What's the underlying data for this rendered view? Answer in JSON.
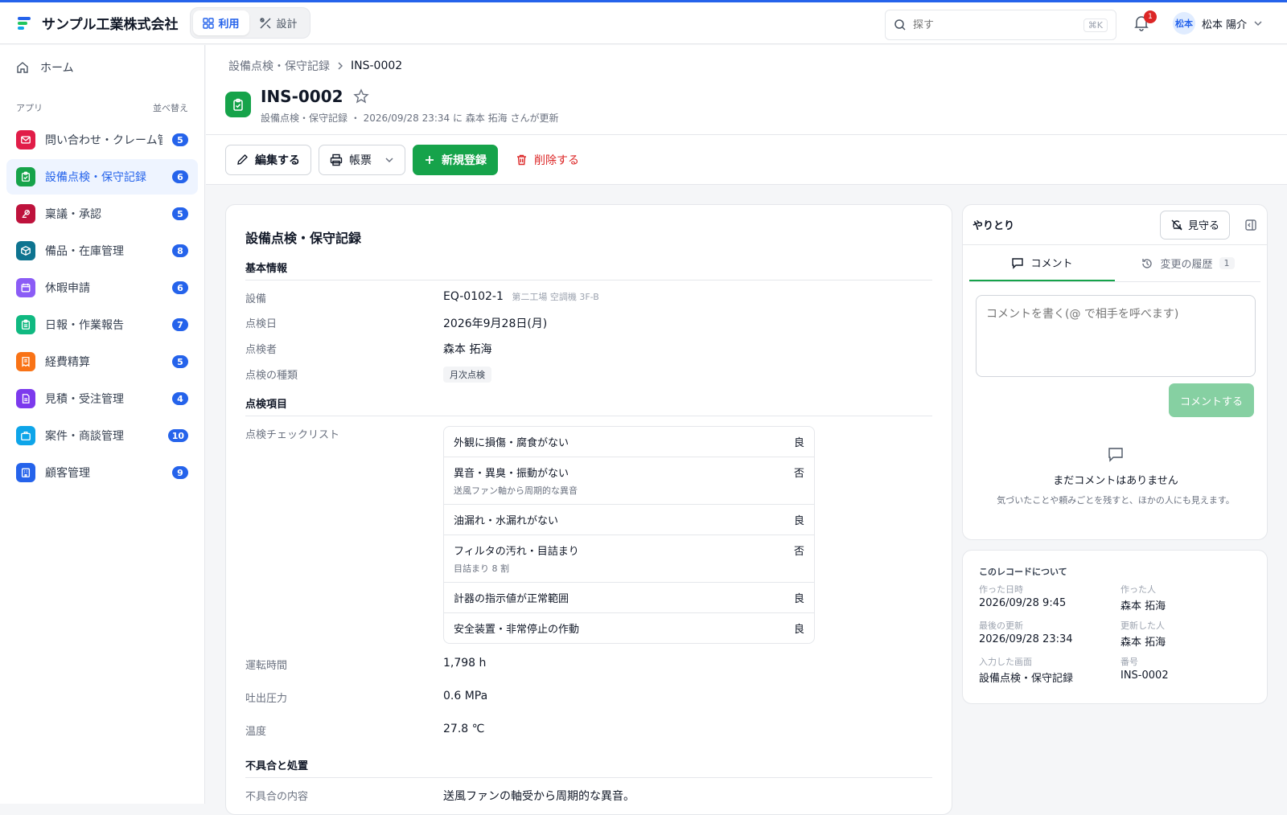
{
  "header": {
    "company": "サンプル工業株式会社",
    "modes": [
      {
        "label": "利用",
        "active": true
      },
      {
        "label": "設計",
        "active": false
      }
    ],
    "search_placeholder": "探す",
    "search_shortcut": "⌘K",
    "notification_count": "1",
    "user_avatar": "松本",
    "user_name": "松本 陽介"
  },
  "sidebar": {
    "home": "ホーム",
    "apps_heading": "アプリ",
    "sort_label": "並べ替え",
    "items": [
      {
        "label": "問い合わせ・クレーム管…",
        "count": "5",
        "color": "#e11d48",
        "icon": "mail-icon",
        "active": false
      },
      {
        "label": "設備点検・保守記録",
        "count": "6",
        "color": "#16a34a",
        "icon": "clipboard-check-icon",
        "active": true
      },
      {
        "label": "稟議・承認",
        "count": "5",
        "color": "#be123c",
        "icon": "stamp-icon",
        "active": false
      },
      {
        "label": "備品・在庫管理",
        "count": "8",
        "color": "#0e7490",
        "icon": "box-icon",
        "active": false
      },
      {
        "label": "休暇申請",
        "count": "6",
        "color": "#8b5cf6",
        "icon": "calendar-icon",
        "active": false
      },
      {
        "label": "日報・作業報告",
        "count": "7",
        "color": "#10b981",
        "icon": "clipboard-icon",
        "active": false
      },
      {
        "label": "経費精算",
        "count": "5",
        "color": "#f97316",
        "icon": "receipt-icon",
        "active": false
      },
      {
        "label": "見積・受注管理",
        "count": "4",
        "color": "#7c3aed",
        "icon": "document-icon",
        "active": false
      },
      {
        "label": "案件・商談管理",
        "count": "10",
        "color": "#0ea5e9",
        "icon": "briefcase-icon",
        "active": false
      },
      {
        "label": "顧客管理",
        "count": "9",
        "color": "#2563eb",
        "icon": "building-icon",
        "active": false
      }
    ]
  },
  "page": {
    "breadcrumb_parent": "設備点検・保守記録",
    "breadcrumb_current": "INS-0002",
    "title": "INS-0002",
    "subtitle": "設備点検・保守記録 ・ 2026/09/28 23:34 に 森本 拓海 さんが更新"
  },
  "toolbar": {
    "edit": "編集する",
    "print": "帳票",
    "create": "新規登録",
    "delete": "削除する"
  },
  "record": {
    "card_title": "設備点検・保守記録",
    "sections": {
      "basic": "基本情報",
      "items": "点検項目",
      "issues": "不具合と処置"
    },
    "equipment_label": "設備",
    "equipment_value": "EQ-0102-1",
    "equipment_note": "第二工場 空調機 3F-B",
    "date_label": "点検日",
    "date_value": "2026年9月28日(月)",
    "inspector_label": "点検者",
    "inspector_value": "森本 拓海",
    "type_label": "点検の種類",
    "type_value": "月次点検",
    "checklist_label": "点検チェックリスト",
    "checklist": [
      {
        "item": "外観に損傷・腐食がない",
        "result": "良",
        "note": ""
      },
      {
        "item": "異音・異臭・振動がない",
        "result": "否",
        "note": "送風ファン軸から周期的な異音"
      },
      {
        "item": "油漏れ・水漏れがない",
        "result": "良",
        "note": ""
      },
      {
        "item": "フィルタの汚れ・目詰まり",
        "result": "否",
        "note": "目詰まり 8 割"
      },
      {
        "item": "計器の指示値が正常範囲",
        "result": "良",
        "note": ""
      },
      {
        "item": "安全装置・非常停止の作動",
        "result": "良",
        "note": ""
      }
    ],
    "hours_label": "運転時間",
    "hours_value": "1,798 h",
    "pressure_label": "吐出圧力",
    "pressure_value": "0.6 MPa",
    "temp_label": "温度",
    "temp_value": "27.8 ℃",
    "issue_label": "不具合の内容",
    "issue_value": "送風ファンの軸受から周期的な異音。"
  },
  "comments": {
    "title": "やりとり",
    "watch": "見守る",
    "tab_comment": "コメント",
    "tab_history": "変更の履歴",
    "history_count": "1",
    "placeholder": "コメントを書く(@ で相手を呼べます)",
    "submit": "コメントする",
    "empty_title": "まだコメントはありません",
    "empty_desc": "気づいたことや頼みごとを残すと、ほかの人にも見えます。"
  },
  "about": {
    "title": "このレコードについて",
    "fields": [
      {
        "key": "作った日時",
        "value": "2026/09/28 9:45"
      },
      {
        "key": "作った人",
        "value": "森本 拓海"
      },
      {
        "key": "最後の更新",
        "value": "2026/09/28 23:34"
      },
      {
        "key": "更新した人",
        "value": "森本 拓海"
      },
      {
        "key": "入力した画面",
        "value": "設備点検・保守記録"
      },
      {
        "key": "番号",
        "value": "INS-0002"
      }
    ]
  },
  "colors": {
    "accent": "#2563eb",
    "primary_green": "#16a34a",
    "danger": "#dc2626"
  }
}
